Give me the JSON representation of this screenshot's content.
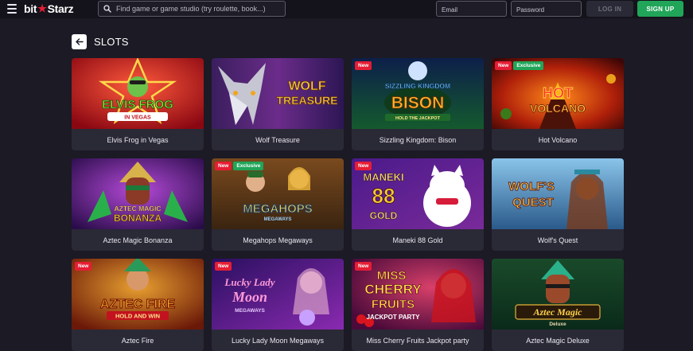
{
  "header": {
    "logo": {
      "left": "bit",
      "right": "Starz"
    },
    "search_placeholder": "Find game or game studio (try roulette, book...)",
    "email_placeholder": "Email",
    "password_placeholder": "Password",
    "login_label": "LOG IN",
    "signup_label": "SIGN UP"
  },
  "section": {
    "title": "SLOTS"
  },
  "badges": {
    "new": "New",
    "exclusive": "Exclusive"
  },
  "games": [
    {
      "name": "Elvis Frog in Vegas",
      "art": [
        "ELVIS FROG",
        "IN VEGAS"
      ],
      "new": false,
      "exclusive": false
    },
    {
      "name": "Wolf Treasure",
      "art": [
        "WOLF",
        "TREASURE"
      ],
      "new": false,
      "exclusive": false
    },
    {
      "name": "Sizzling Kingdom: Bison",
      "art": [
        "SIZZLING KINGDOM",
        "BISON",
        "HOLD THE JACKPOT"
      ],
      "new": true,
      "exclusive": false
    },
    {
      "name": "Hot Volcano",
      "art": [
        "HOT",
        "VOLCANO"
      ],
      "new": true,
      "exclusive": true
    },
    {
      "name": "Aztec Magic Bonanza",
      "art": [
        "AZTEC MAGIC",
        "BONANZA"
      ],
      "new": false,
      "exclusive": false
    },
    {
      "name": "Megahops Megaways",
      "art": [
        "MEGAHOPS",
        "MEGAWAYS"
      ],
      "new": true,
      "exclusive": true
    },
    {
      "name": "Maneki 88 Gold",
      "art": [
        "MANEKI",
        "88",
        "GOLD"
      ],
      "new": true,
      "exclusive": false
    },
    {
      "name": "Wolf's Quest",
      "art": [
        "WOLF'S",
        "QUEST"
      ],
      "new": false,
      "exclusive": false
    },
    {
      "name": "Aztec Fire",
      "art": [
        "AZTEC FIRE",
        "HOLD AND WIN"
      ],
      "new": true,
      "exclusive": false
    },
    {
      "name": "Lucky Lady Moon Megaways",
      "art": [
        "Lucky Lady",
        "Moon",
        "MEGAWAYS"
      ],
      "new": true,
      "exclusive": false
    },
    {
      "name": "Miss Cherry Fruits Jackpot party",
      "art": [
        "MISS",
        "CHERRY",
        "FRUITS",
        "JACKPOT PARTY"
      ],
      "new": true,
      "exclusive": false
    },
    {
      "name": "Aztec Magic Deluxe",
      "art": [
        "Aztec Magic",
        "Deluxe"
      ],
      "new": false,
      "exclusive": false
    }
  ]
}
